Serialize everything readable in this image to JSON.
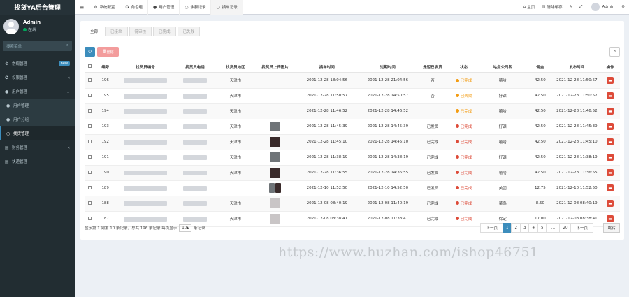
{
  "app": {
    "title": "找货YA后台管理"
  },
  "user": {
    "name": "Admin",
    "status": "在线"
  },
  "sidebar": {
    "search_placeholder": "搜索菜单",
    "items": [
      {
        "label": "常规管理",
        "badge": "new"
      },
      {
        "label": "权限管理"
      },
      {
        "label": "用户管理"
      },
      {
        "label": "用户管理"
      },
      {
        "label": "用户分组"
      },
      {
        "label": "找货管理"
      },
      {
        "label": "财务管理"
      },
      {
        "label": "快递管理"
      }
    ]
  },
  "header": {
    "tabs": [
      {
        "label": "系统配置"
      },
      {
        "label": "角色组"
      },
      {
        "label": "用户管理"
      },
      {
        "label": "余额记录"
      },
      {
        "label": "接单记录"
      }
    ],
    "actions": {
      "home": "主页",
      "clear_cache": "清除缓存",
      "user": "Admin"
    }
  },
  "filter_tabs": [
    "全部",
    "已接单",
    "待审核",
    "已完成",
    "已失败"
  ],
  "toolbar": {
    "delete_label": "删除"
  },
  "table": {
    "columns": [
      "编号",
      "找货员编号",
      "找货员电话",
      "找货员地区",
      "找货员上传图片",
      "接单时间",
      "过期时间",
      "是否已发货",
      "状态",
      "站点公司名",
      "佣金",
      "发布时间",
      "操作"
    ],
    "rows": [
      {
        "id": "196",
        "region": "天津市",
        "order_time": "2021-12-28 18:04:56",
        "expire_time": "2021-12-28 21:04:56",
        "shipped": "否",
        "status": "已完成",
        "status_color": "orange",
        "company": "嘻哈",
        "commission": "42.50",
        "publish_time": "2021-12-28 11:50:57",
        "image": "none"
      },
      {
        "id": "195",
        "region": "天津市",
        "order_time": "2021-12-28 11:50:57",
        "expire_time": "2021-12-28 14:50:57",
        "shipped": "否",
        "status": "已失败",
        "status_color": "orange",
        "company": "好课",
        "commission": "42.50",
        "publish_time": "2021-12-28 11:50:57",
        "image": "none"
      },
      {
        "id": "194",
        "region": "天津市",
        "order_time": "2021-12-28 11:46:52",
        "expire_time": "2021-12-28 14:46:52",
        "shipped": "",
        "status": "已完成",
        "status_color": "orange",
        "company": "嘻哈",
        "commission": "42.50",
        "publish_time": "2021-12-28 11:46:52",
        "image": "none"
      },
      {
        "id": "193",
        "region": "天津市",
        "order_time": "2021-12-28 11:45:39",
        "expire_time": "2021-12-28 14:45:39",
        "shipped": "已发货",
        "status": "已完成",
        "status_color": "red",
        "company": "好课",
        "commission": "42.50",
        "publish_time": "2021-12-28 11:45:39",
        "image": "gray"
      },
      {
        "id": "192",
        "region": "天津市",
        "order_time": "2021-12-28 11:45:10",
        "expire_time": "2021-12-28 14:45:10",
        "shipped": "已完成",
        "status": "已完成",
        "status_color": "red",
        "company": "嘻哈",
        "commission": "42.50",
        "publish_time": "2021-12-28 11:45:10",
        "image": "dark"
      },
      {
        "id": "191",
        "region": "天津市",
        "order_time": "2021-12-28 11:38:19",
        "expire_time": "2021-12-28 14:38:19",
        "shipped": "已完成",
        "status": "已完成",
        "status_color": "red",
        "company": "好课",
        "commission": "42.50",
        "publish_time": "2021-12-28 11:38:19",
        "image": "gray"
      },
      {
        "id": "190",
        "region": "天津市",
        "order_time": "2021-12-28 11:36:55",
        "expire_time": "2021-12-28 14:36:55",
        "shipped": "已发货",
        "status": "已完成",
        "status_color": "red",
        "company": "嘻哈",
        "commission": "42.50",
        "publish_time": "2021-12-28 11:36:55",
        "image": "dark"
      },
      {
        "id": "189",
        "region": "",
        "order_time": "2021-12-10 11:52:50",
        "expire_time": "2021-12-10 14:52:50",
        "shipped": "已发货",
        "status": "已完成",
        "status_color": "red",
        "company": "美团",
        "commission": "12.75",
        "publish_time": "2021-12-10 11:52:50",
        "image": "pair"
      },
      {
        "id": "188",
        "region": "天津市",
        "order_time": "2021-12-08 08:40:19",
        "expire_time": "2021-12-08 11:40:19",
        "shipped": "已完成",
        "status": "已完成",
        "status_color": "red",
        "company": "菜鸟",
        "commission": "8.50",
        "publish_time": "2021-12-08 08:40:19",
        "image": "light"
      },
      {
        "id": "187",
        "region": "天津市",
        "order_time": "2021-12-08 08:38:41",
        "expire_time": "2021-12-08 11:38:41",
        "shipped": "已完成",
        "status": "已完成",
        "status_color": "red",
        "company": "保定",
        "commission": "17.00",
        "publish_time": "2021-12-08 08:38:41",
        "image": "light"
      }
    ]
  },
  "footer": {
    "summary": "显示第 1 到第 10 条记录，总共 196 条记录 每页显示",
    "page_size": "10",
    "suffix": "条记录",
    "pager": {
      "prev": "上一页",
      "pages": [
        "1",
        "2",
        "3",
        "4",
        "5"
      ],
      "ellipsis": "...",
      "last": "20",
      "next": "下一页"
    },
    "jump": "跳转"
  },
  "watermark": "https://www.huzhan.com/ishop46751"
}
